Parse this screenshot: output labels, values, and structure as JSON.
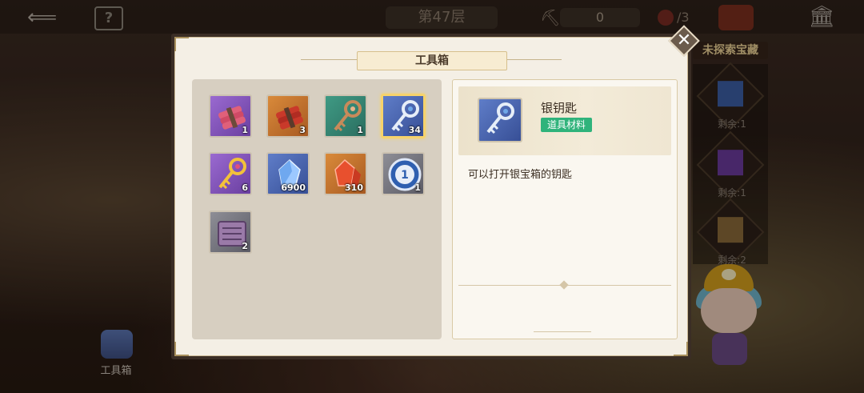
{
  "hud": {
    "floor": "第47层",
    "pick_count": "0",
    "bomb_count": "/3",
    "help_icon": "?"
  },
  "side": {
    "title": "未探索宝藏",
    "items": [
      {
        "remaining": "剩余:1",
        "color": "#3a5fa8"
      },
      {
        "remaining": "剩余:1",
        "color": "#6b3aa0"
      },
      {
        "remaining": "剩余:2",
        "color": "#8a6a3a"
      }
    ]
  },
  "toolbox_button": {
    "label": "工具箱"
  },
  "dialog": {
    "title": "工具箱",
    "close_glyph": "✕"
  },
  "inventory": {
    "items": [
      {
        "name": "粉色炸药",
        "count": "1",
        "icon": "dynamite-icon",
        "bg": "purple"
      },
      {
        "name": "橙色炸药",
        "count": "3",
        "icon": "dynamite-icon",
        "bg": "orange"
      },
      {
        "name": "铜钥匙",
        "count": "1",
        "icon": "key-icon",
        "bg": "green"
      },
      {
        "name": "银钥匙",
        "count": "34",
        "icon": "key-icon",
        "bg": "blue",
        "selected": true
      },
      {
        "name": "金钥匙",
        "count": "6",
        "icon": "key-icon",
        "bg": "purple"
      },
      {
        "name": "蓝色晶石",
        "count": "6900",
        "icon": "crystal-icon",
        "bg": "blue"
      },
      {
        "name": "红色晶石",
        "count": "310",
        "icon": "crystal-icon",
        "bg": "orange"
      },
      {
        "name": "蓝色代币",
        "count": "1",
        "icon": "coin-icon",
        "bg": "gray"
      },
      {
        "name": "地图卷轴",
        "count": "2",
        "icon": "scroll-icon",
        "bg": "gray"
      }
    ]
  },
  "detail": {
    "name": "银钥匙",
    "tag": "道具材料",
    "description": "可以打开银宝箱的钥匙",
    "tag_color": "#2fb37b"
  },
  "colors": {
    "panel_bg": "#f4efe5",
    "inventory_bg": "#d7cfc1",
    "selected_border": "#f6d36b"
  }
}
